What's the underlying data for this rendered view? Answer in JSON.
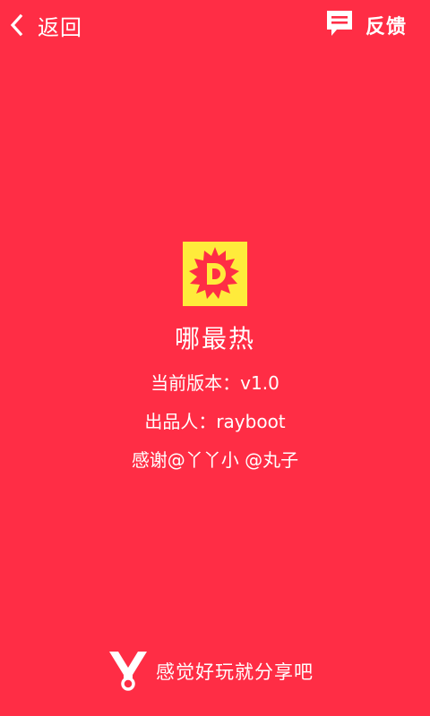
{
  "colors": {
    "background": "#FF2D45",
    "text": "#FFFFFF",
    "logo_background": "#FFEB3B"
  },
  "topbar": {
    "back_label": "返回",
    "back_icon": "chevron-left-icon",
    "feedback_label": "反馈",
    "feedback_icon": "chat-bubble-icon"
  },
  "about": {
    "app_name": "哪最热",
    "version_line": "当前版本：v1.0",
    "producer_line": "出品人：rayboot",
    "thanks_line": "感谢@丫丫小 @丸子",
    "logo_icon": "sunburst-d-logo"
  },
  "share": {
    "label": "感觉好玩就分享吧",
    "icon": "share-icon"
  }
}
